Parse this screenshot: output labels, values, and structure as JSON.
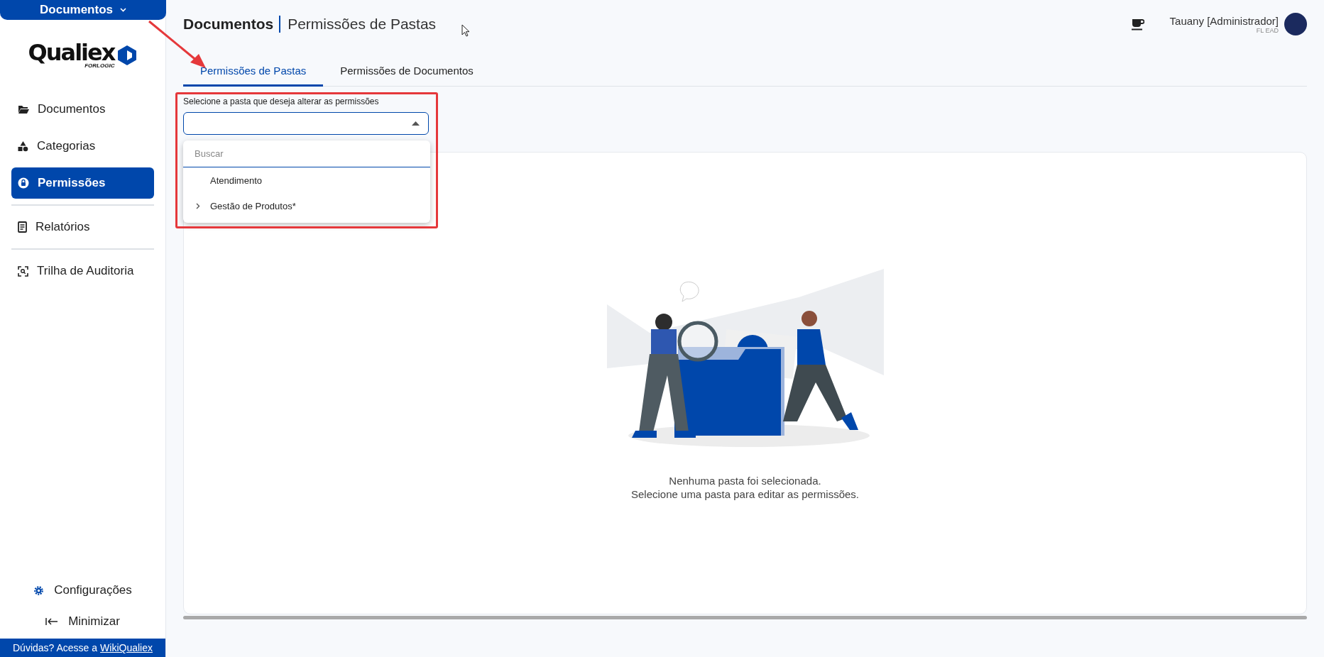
{
  "module_switcher": {
    "label": "Documentos"
  },
  "logo": {
    "name": "Qualiex",
    "tagline": "FORLOGIC"
  },
  "sidebar": {
    "groups": [
      [
        {
          "label": "Documentos",
          "selected": false
        },
        {
          "label": "Categorias",
          "selected": false
        },
        {
          "label": "Permissões",
          "selected": true
        }
      ],
      [
        {
          "label": "Relatórios",
          "selected": false
        }
      ],
      [
        {
          "label": "Trilha de Auditoria",
          "selected": false
        }
      ]
    ],
    "settings": "Configurações",
    "minimize": "Minimizar"
  },
  "footer": {
    "text": "Dúvidas? Acesse a",
    "link": "WikiQualiex"
  },
  "header": {
    "module": "Documentos",
    "page": "Permissões de Pastas",
    "user": "Tauany [Administrador]",
    "unit": "FL EAD"
  },
  "tabs": [
    {
      "label": "Permissões de Pastas",
      "selected": true
    },
    {
      "label": "Permissões de Documentos",
      "selected": false
    }
  ],
  "folder_select": {
    "label": "Selecione a pasta que deseja alterar as permissões",
    "open": true,
    "search": {
      "placeholder": "Buscar"
    },
    "options": [
      {
        "label": "Atendimento",
        "has_children": false
      },
      {
        "label": "Gestão de Produtos*",
        "has_children": true
      }
    ]
  },
  "empty_state": {
    "lines": [
      "Nenhuma pasta foi selecionada.",
      "Selecione uma pasta para editar as permissões."
    ]
  }
}
